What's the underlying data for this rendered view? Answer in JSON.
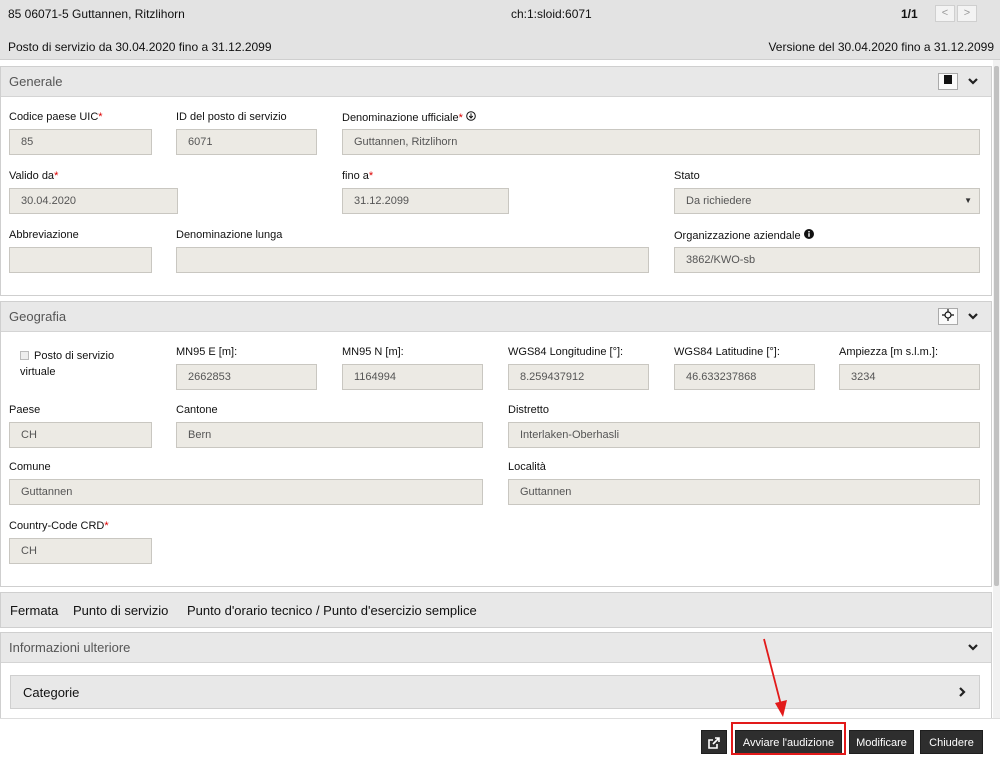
{
  "header": {
    "title": "85 06071-5 Guttannen, Ritzlihorn",
    "sloid": "ch:1:sloid:6071",
    "pager": "1/1",
    "validity": "Posto di servizio da 30.04.2020 fino a 31.12.2099",
    "version": "Versione del 30.04.2020 fino a 31.12.2099"
  },
  "generale": {
    "title": "Generale",
    "uic_label": "Codice paese UIC",
    "uic_value": "85",
    "id_label": "ID del posto di servizio",
    "id_value": "6071",
    "denominazione_label": "Denominazione ufficiale",
    "denominazione_value": "Guttannen, Ritzlihorn",
    "valido_label": "Valido da",
    "valido_value": "30.04.2020",
    "fino_label": "fino a",
    "fino_value": "31.12.2099",
    "stato_label": "Stato",
    "stato_value": "Da richiedere",
    "abbreviazione_label": "Abbreviazione",
    "abbreviazione_value": "",
    "lunga_label": "Denominazione lunga",
    "lunga_value": "",
    "org_label": "Organizzazione aziendale",
    "org_value": "3862/KWO-sb"
  },
  "geografia": {
    "title": "Geografia",
    "virtuale_label_1": "Posto di servizio",
    "virtuale_label_2": "virtuale",
    "e_label": "MN95 E [m]:",
    "e_value": "2662853",
    "n_label": "MN95 N [m]:",
    "n_value": "1164994",
    "lon_label": "WGS84 Longitudine [°]:",
    "lon_value": "8.259437912",
    "lat_label": "WGS84 Latitudine [°]:",
    "lat_value": "46.633237868",
    "alt_label": "Ampiezza [m s.l.m.]:",
    "alt_value": "3234",
    "paese_label": "Paese",
    "paese_value": "CH",
    "cantone_label": "Cantone",
    "cantone_value": "Bern",
    "distretto_label": "Distretto",
    "distretto_value": "Interlaken-Oberhasli",
    "comune_label": "Comune",
    "comune_value": "Guttannen",
    "localita_label": "Località",
    "localita_value": "Guttannen",
    "crd_label": "Country-Code CRD",
    "crd_value": "CH"
  },
  "tipi": {
    "fermata": "Fermata",
    "punto_servizio": "Punto di servizio",
    "orario": "Punto d'orario tecnico / Punto d'esercizio semplice"
  },
  "ulteriore": {
    "title": "Informazioni ulteriore",
    "categorie": "Categorie"
  },
  "footer": {
    "audizione": "Avviare l'audizione",
    "modificare": "Modificare",
    "chiudere": "Chiudere"
  },
  "icons": {
    "prev": "chevron-left-icon",
    "next": "chevron-right-icon",
    "info": "info-circle-icon",
    "external": "external-link-icon"
  },
  "colors": {
    "highlight": "#e21a1a",
    "button": "#2e2e2e",
    "required": "#d00000"
  }
}
